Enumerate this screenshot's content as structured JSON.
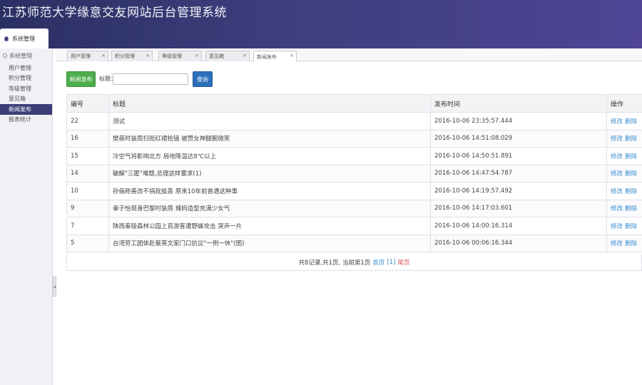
{
  "app": {
    "title": "江苏师范大学缘意交友网站后台管理系统"
  },
  "nav": {
    "tab_label": "系统管理"
  },
  "sidebar": {
    "header": "系统管理",
    "items": [
      {
        "label": "用户管理"
      },
      {
        "label": "积分管理"
      },
      {
        "label": "等级管理"
      },
      {
        "label": "意见箱"
      },
      {
        "label": "新闻发布",
        "active": true
      },
      {
        "label": "报表统计"
      }
    ]
  },
  "tabs": [
    {
      "label": "用户管理"
    },
    {
      "label": "积分管理"
    },
    {
      "label": "等级管理"
    },
    {
      "label": "意见箱"
    },
    {
      "label": "新闻发布",
      "active": true
    }
  ],
  "toolbar": {
    "new_label": "新闻发布",
    "title_label": "标题：",
    "title_value": "",
    "query_label": "查询"
  },
  "table": {
    "headers": {
      "id": "编号",
      "title": "标题",
      "time": "发布时间",
      "ops": "操作"
    },
    "edit_label": "修改",
    "delete_label": "删除",
    "rows": [
      {
        "id": "22",
        "title": "测试",
        "time": "2016-10-06 23:35:57.444"
      },
      {
        "id": "16",
        "title": "樊莜时装周扫街红裙抢镜 被赞女神腿腕微笑",
        "time": "2016-10-06 14:51:08.029"
      },
      {
        "id": "15",
        "title": "冷空气将影响北方 局地降温达8℃以上",
        "time": "2016-10-06 14:50:51.891"
      },
      {
        "id": "14",
        "title": "破解\"三匿\"难题,总理这样要求(1)",
        "time": "2016-10-06 14:47:54.787"
      },
      {
        "id": "10",
        "title": "孙俪称善改不捐款挨轰 原来10年前曾遇这种事",
        "time": "2016-10-06 14:19:57.492"
      },
      {
        "id": "9",
        "title": "章子怡现身巴黎时装周 辣妈造型充满少女气",
        "time": "2016-10-06 14:17:03.601"
      },
      {
        "id": "7",
        "title": "陕西秦陵森林公园上百游客遭野蜂攻击 哭声一片",
        "time": "2016-10-06 14:00:16.314"
      },
      {
        "id": "5",
        "title": "台湾劳工团体赴蔡英文家门口抗议\"一例一休\"(图)",
        "time": "2016-10-06 00:06:16.344"
      }
    ]
  },
  "pager": {
    "summary": "共8记录,共1页, 当前第1页",
    "first": "首页",
    "current": "[1]",
    "last": "尾页"
  }
}
